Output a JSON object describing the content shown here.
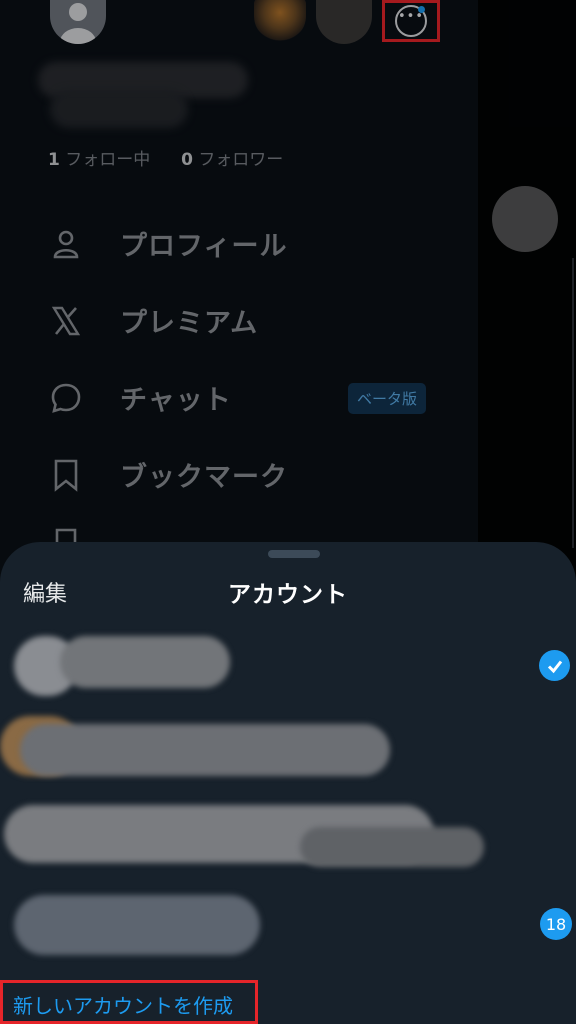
{
  "drawer": {
    "following_count": "1",
    "following_label": "フォロー中",
    "followers_count": "0",
    "followers_label": "フォロワー",
    "menu": [
      {
        "label": "プロフィール",
        "icon": "person-icon"
      },
      {
        "label": "プレミアム",
        "icon": "x-logo-icon"
      },
      {
        "label": "チャット",
        "icon": "chat-bubble-icon",
        "badge": "ベータ版"
      },
      {
        "label": "ブックマーク",
        "icon": "bookmark-icon"
      }
    ],
    "more_icon": "more-options-icon"
  },
  "sheet": {
    "edit_label": "編集",
    "title": "アカウント",
    "selected_badge": "checkmark-icon",
    "notification_count": "18",
    "create_account_label": "新しいアカウントを作成"
  },
  "colors": {
    "accent": "#1d9bf0",
    "highlight_box": "#e5252a",
    "sheet_background": "#17212b",
    "drawer_background": "#0b1016"
  }
}
